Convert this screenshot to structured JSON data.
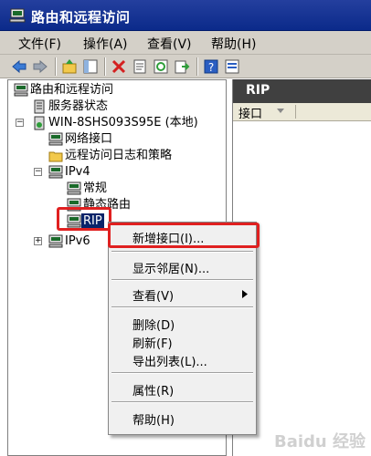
{
  "window": {
    "title": "路由和远程访问"
  },
  "menu": {
    "file": "文件(F)",
    "action": "操作(A)",
    "view": "查看(V)",
    "help": "帮助(H)"
  },
  "toolbar": {
    "icons": [
      "back-arrow-icon",
      "forward-arrow-icon",
      "up-folder-icon",
      "show-tree-icon",
      "delete-icon",
      "properties-icon",
      "refresh-icon",
      "export-icon",
      "help-icon",
      "console-icon"
    ]
  },
  "tree": {
    "root": "路由和远程访问",
    "server_status": "服务器状态",
    "server": "WIN-8SHS093S95E (本地)",
    "network_interfaces": "网络接口",
    "remote_access_logging": "远程访问日志和策略",
    "ipv4": "IPv4",
    "general": "常规",
    "static_routes": "静态路由",
    "rip": "RIP",
    "ipv6": "IPv6"
  },
  "right_pane": {
    "header": "RIP",
    "column_interface": "接口"
  },
  "context_menu": {
    "new_interface": "新增接口(I)...",
    "show_neighbors": "显示邻居(N)...",
    "view": "查看(V)",
    "delete": "删除(D)",
    "refresh": "刷新(F)",
    "export_list": "导出列表(L)...",
    "properties": "属性(R)",
    "help": "帮助(H)"
  },
  "colors": {
    "titlebar": "#0b2a8a",
    "selection": "#0a246a",
    "annotation": "#e02020"
  }
}
